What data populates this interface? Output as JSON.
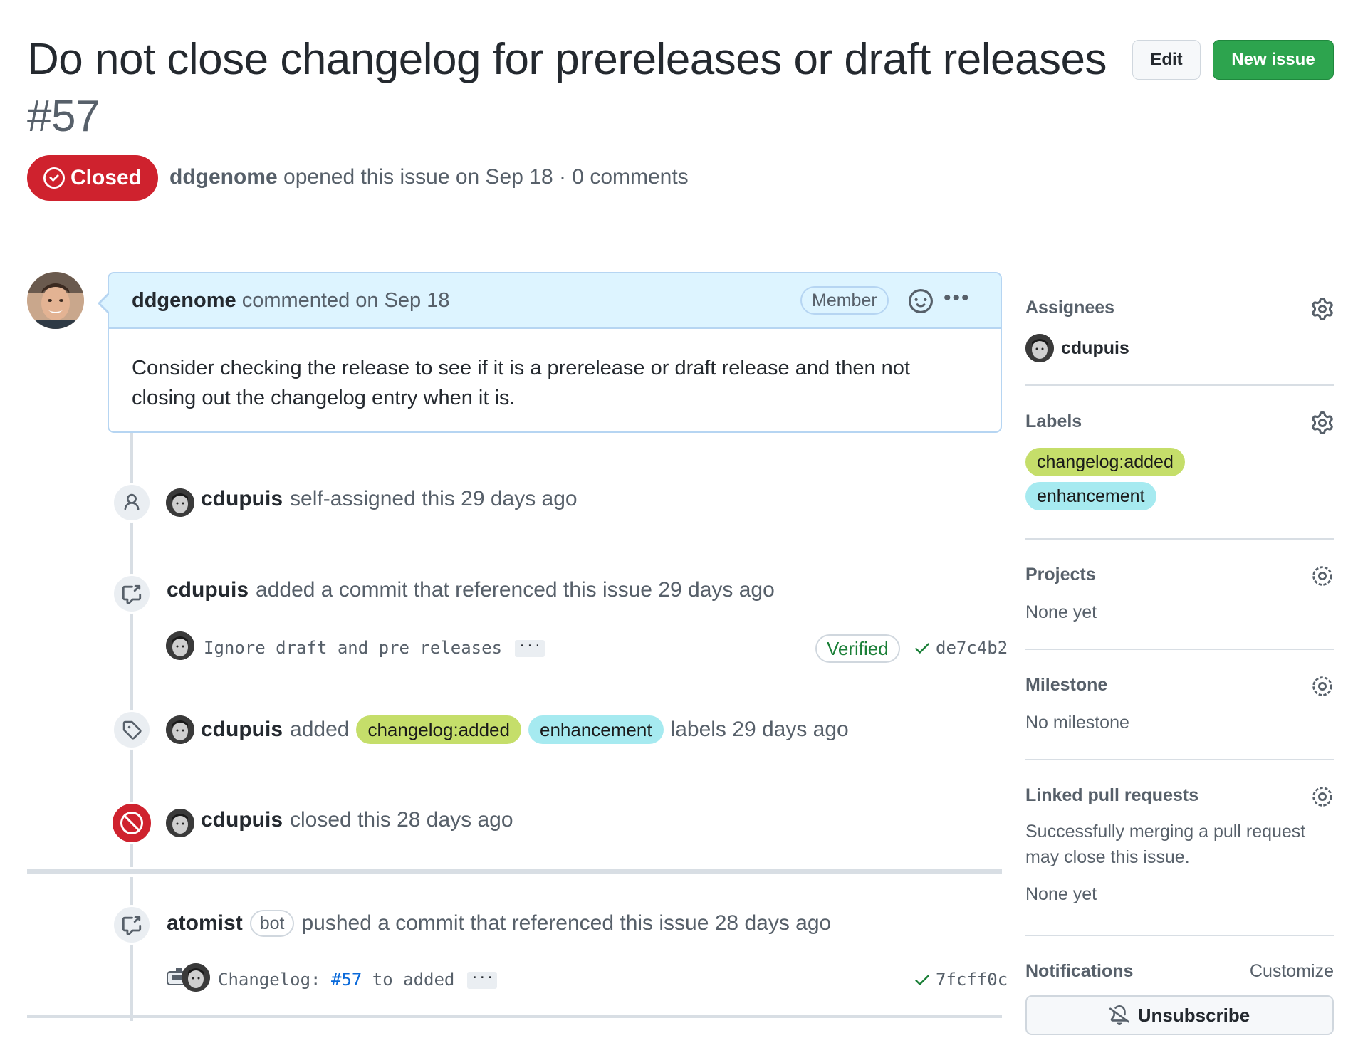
{
  "issue": {
    "title": "Do not close changelog for prereleases or draft releases",
    "number": "#57",
    "edit_label": "Edit",
    "new_issue_label": "New issue",
    "state": "Closed",
    "author": "ddgenome",
    "meta": "opened this issue on Sep 18 · 0 comments"
  },
  "comment": {
    "author": "ddgenome",
    "action": "commented on Sep 18",
    "role": "Member",
    "body": "Consider checking the release to see if it is a prerelease or draft release and then not closing out the changelog entry when it is."
  },
  "events": {
    "assign": {
      "actor": "cdupuis",
      "text": "self-assigned this 29 days ago"
    },
    "commit_ref": {
      "actor": "cdupuis",
      "text": "added a commit that referenced this issue 29 days ago",
      "message": "Ignore draft and pre releases",
      "verified": "Verified",
      "sha": "de7c4b2"
    },
    "labels": {
      "actor": "cdupuis",
      "added": "added",
      "label1": "changelog:added",
      "label2": "enhancement",
      "text": "labels 29 days ago"
    },
    "closed": {
      "actor": "cdupuis",
      "text": "closed this 28 days ago"
    },
    "push": {
      "actor": "atomist",
      "bot": "bot",
      "text": "pushed a commit that referenced this issue 28 days ago",
      "message_prefix": "Changelog:",
      "message_link": "#57",
      "message_suffix": "to added",
      "sha": "7fcff0c"
    }
  },
  "sidebar": {
    "assignees": {
      "title": "Assignees",
      "user": "cdupuis"
    },
    "labels": {
      "title": "Labels",
      "items": [
        "changelog:added",
        "enhancement"
      ]
    },
    "projects": {
      "title": "Projects",
      "value": "None yet"
    },
    "milestone": {
      "title": "Milestone",
      "value": "No milestone"
    },
    "linked": {
      "title": "Linked pull requests",
      "desc": "Successfully merging a pull request may close this issue.",
      "value": "None yet"
    },
    "notifications": {
      "title": "Notifications",
      "customize": "Customize",
      "unsubscribe": "Unsubscribe"
    }
  },
  "colors": {
    "closed": "#cf222e",
    "primary": "#2da44e",
    "label_changelog": "#c5de6a",
    "label_enhancement": "#a6eaf0",
    "verified": "#1a7f37"
  }
}
